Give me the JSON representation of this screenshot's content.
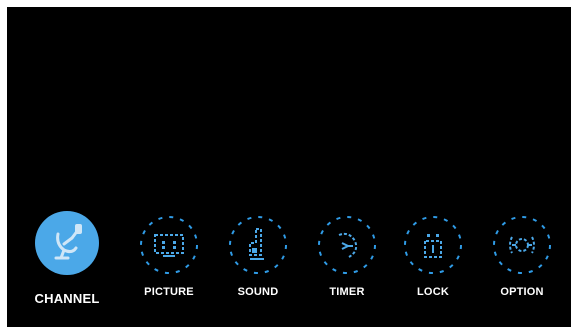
{
  "menu": {
    "items": [
      {
        "label": "CHANNEL",
        "icon": "satellite-dish-icon",
        "selected": true
      },
      {
        "label": "PICTURE",
        "icon": "picture-screen-icon",
        "selected": false
      },
      {
        "label": "SOUND",
        "icon": "speaker-icon",
        "selected": false
      },
      {
        "label": "TIMER",
        "icon": "timer-icon",
        "selected": false
      },
      {
        "label": "LOCK",
        "icon": "lock-icon",
        "selected": false
      },
      {
        "label": "OPTION",
        "icon": "option-gear-icon",
        "selected": false
      }
    ]
  },
  "colors": {
    "accent": "#4ba8e8",
    "ring": "#2f9be6",
    "background": "#000000",
    "text": "#ffffff"
  }
}
